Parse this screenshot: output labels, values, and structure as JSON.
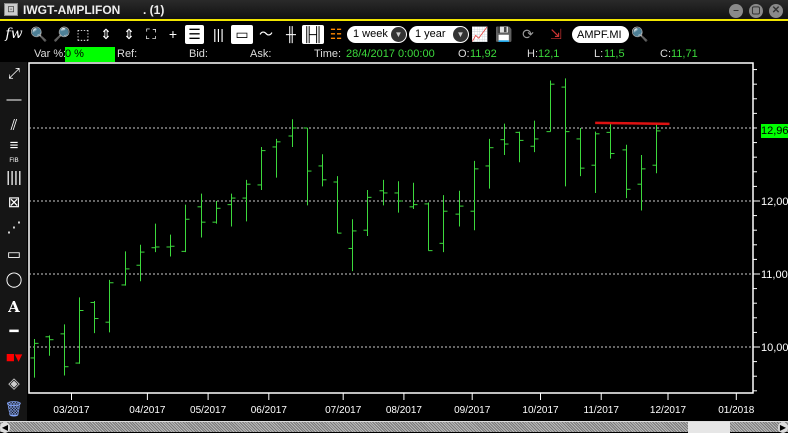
{
  "window": {
    "title": "IWGT-AMPLIFON",
    "subtitle": ". (1)",
    "minimize": "–",
    "maximize": "▢",
    "close": "✕"
  },
  "toolbar": {
    "fx": "fw",
    "period": "1 week",
    "range": "1 year",
    "symbol": "AMPF.MI"
  },
  "info": {
    "var_label": "Var %:",
    "var_value": "0 %",
    "ref_label": "Ref:",
    "bid_label": "Bid:",
    "ask_label": "Ask:",
    "time_label": "Time:",
    "time_value": "28/4/2017 0:00:00",
    "open_label": "O:",
    "open": "11,92",
    "high_label": "H:",
    "high": "12,1",
    "low_label": "L:",
    "low": "11,5",
    "close_label": "C:",
    "close": "11,71"
  },
  "left_tools": {
    "fib_label": "FIB",
    "text_tool": "A"
  },
  "colors": {
    "bar": "#3cd93c",
    "grid": "#cccccc",
    "trendline": "#dd1111",
    "badge": "#00ff00",
    "drawing_color": "#ff0000"
  },
  "chart_data": {
    "type": "ohlc",
    "ylim": [
      9.37,
      13.89
    ],
    "yticks": [
      {
        "v": 10,
        "label": "10,00"
      },
      {
        "v": 11,
        "label": "11,00"
      },
      {
        "v": 12,
        "label": "12,00"
      }
    ],
    "last_price": {
      "v": 12.96,
      "label": "12,96"
    },
    "xticks": [
      {
        "i": 2.5,
        "label": "03/2017"
      },
      {
        "i": 7.5,
        "label": "04/2017"
      },
      {
        "i": 11.5,
        "label": "05/2017"
      },
      {
        "i": 15.5,
        "label": "06/2017"
      },
      {
        "i": 20.4,
        "label": "07/2017"
      },
      {
        "i": 24.4,
        "label": "08/2017"
      },
      {
        "i": 28.9,
        "label": "09/2017"
      },
      {
        "i": 33.4,
        "label": "10/2017"
      },
      {
        "i": 37.4,
        "label": "11/2017"
      },
      {
        "i": 41.8,
        "label": "12/2017"
      },
      {
        "i": 46.3,
        "label": "01/2018"
      }
    ],
    "xlim": [
      -0.3,
      47.4
    ],
    "trendline": {
      "i0": 37.0,
      "i1": 41.9,
      "v": 13.07
    },
    "bars": [
      [
        9.85,
        10.11,
        9.58,
        10.05
      ],
      [
        10.14,
        10.16,
        9.88,
        10.1
      ],
      [
        10.18,
        10.31,
        9.61,
        9.73
      ],
      [
        9.78,
        10.68,
        9.77,
        10.5
      ],
      [
        10.61,
        10.63,
        10.19,
        10.39
      ],
      [
        10.34,
        10.92,
        10.2,
        10.88
      ],
      [
        10.85,
        11.31,
        10.84,
        11.07
      ],
      [
        11.12,
        11.4,
        10.9,
        11.3
      ],
      [
        11.36,
        11.69,
        11.3,
        11.37
      ],
      [
        11.37,
        11.54,
        11.24,
        11.38
      ],
      [
        11.31,
        11.95,
        11.3,
        11.75
      ],
      [
        11.92,
        12.1,
        11.5,
        11.71
      ],
      [
        11.71,
        12.0,
        11.69,
        11.9
      ],
      [
        11.95,
        12.1,
        11.65,
        12.04
      ],
      [
        12.04,
        12.29,
        11.72,
        12.23
      ],
      [
        12.22,
        12.74,
        12.15,
        12.69
      ],
      [
        12.74,
        12.85,
        12.32,
        12.81
      ],
      [
        12.89,
        13.12,
        12.74,
        13.0
      ],
      [
        13.0,
        13.0,
        11.94,
        12.41
      ],
      [
        12.48,
        12.64,
        12.2,
        12.29
      ],
      [
        12.26,
        12.34,
        11.56,
        11.56
      ],
      [
        11.35,
        11.75,
        11.04,
        11.59
      ],
      [
        11.6,
        12.15,
        11.52,
        12.05
      ],
      [
        12.14,
        12.29,
        11.94,
        12.11
      ],
      [
        12.11,
        12.27,
        11.84,
        12.0
      ],
      [
        11.92,
        12.25,
        11.89,
        11.95
      ],
      [
        11.96,
        11.98,
        11.32,
        11.32
      ],
      [
        11.42,
        12.08,
        11.3,
        11.86
      ],
      [
        11.82,
        12.14,
        11.65,
        11.93
      ],
      [
        11.86,
        12.55,
        11.6,
        12.44
      ],
      [
        12.48,
        12.85,
        12.17,
        12.73
      ],
      [
        12.84,
        13.06,
        12.63,
        12.78
      ],
      [
        12.94,
        12.95,
        12.53,
        12.83
      ],
      [
        12.75,
        13.1,
        12.67,
        12.85
      ],
      [
        12.95,
        13.65,
        12.95,
        13.6
      ],
      [
        13.56,
        13.68,
        12.2,
        12.95
      ],
      [
        12.85,
        13.0,
        12.34,
        12.45
      ],
      [
        12.49,
        12.95,
        12.11,
        12.92
      ],
      [
        12.94,
        13.06,
        12.58,
        12.65
      ],
      [
        12.7,
        12.77,
        12.04,
        12.16
      ],
      [
        12.23,
        12.63,
        11.87,
        12.44
      ],
      [
        12.49,
        13.05,
        12.38,
        12.96
      ]
    ]
  }
}
